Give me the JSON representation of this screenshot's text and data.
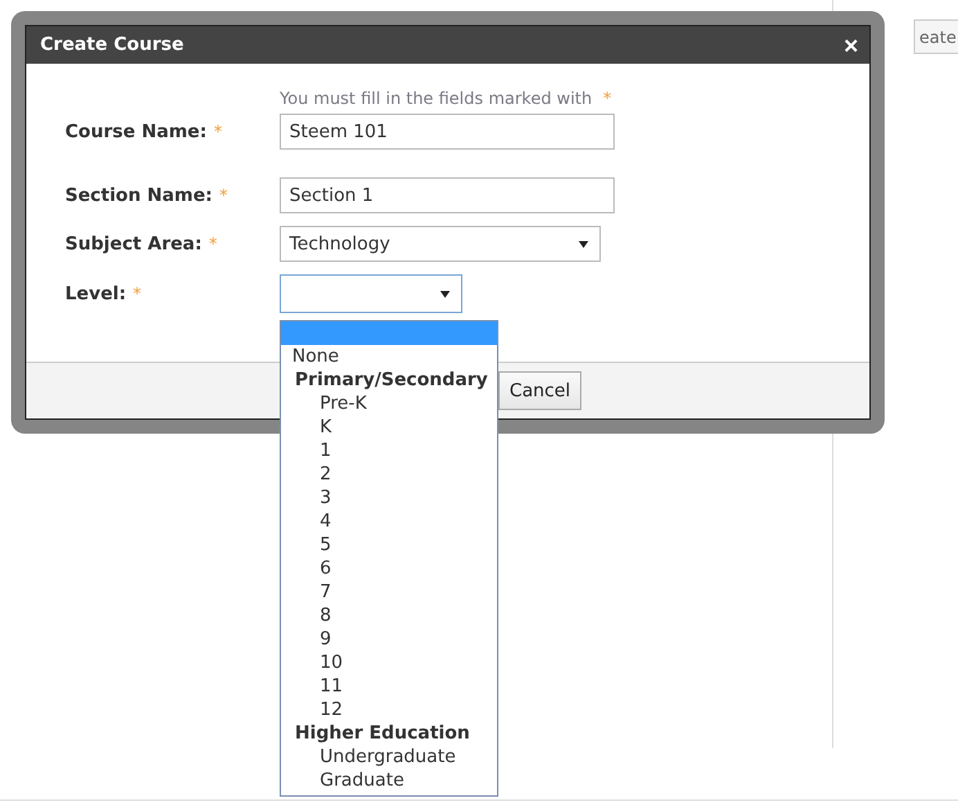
{
  "background": {
    "button_label": "eate"
  },
  "dialog": {
    "title": "Create Course",
    "close": "×",
    "hint": {
      "text": "You must fill in the fields marked with",
      "mark": "*"
    },
    "fields": [
      {
        "kind": "text",
        "label": "Course Name:",
        "mark": "*",
        "value": "Steem 101",
        "focused": false
      },
      {
        "kind": "text",
        "label": "Section Name:",
        "mark": "*",
        "value": "Section 1",
        "focused": false
      },
      {
        "kind": "select",
        "label": "Subject Area:",
        "mark": "*",
        "value": "Technology",
        "focused": false
      },
      {
        "kind": "select-small",
        "label": "Level:",
        "mark": "*",
        "focused": true
      }
    ],
    "buttons": [
      "Cancel"
    ]
  },
  "level_dropdown": {
    "items": [
      {
        "kind": "blank",
        "highlighted": true
      },
      {
        "kind": "option",
        "label": "None",
        "highlighted": false
      },
      {
        "kind": "group",
        "label": "Primary/Secondary",
        "children": [
          {
            "label": "Pre-K",
            "highlighted": false
          },
          {
            "label": "K",
            "highlighted": false
          },
          {
            "label": "1",
            "highlighted": false
          },
          {
            "label": "2",
            "highlighted": false
          },
          {
            "label": "3",
            "highlighted": false
          },
          {
            "label": "4",
            "highlighted": false
          },
          {
            "label": "5",
            "highlighted": false
          },
          {
            "label": "6",
            "highlighted": false
          },
          {
            "label": "7",
            "highlighted": false
          },
          {
            "label": "8",
            "highlighted": false
          },
          {
            "label": "9",
            "highlighted": false
          },
          {
            "label": "10",
            "highlighted": false
          },
          {
            "label": "11",
            "highlighted": false
          },
          {
            "label": "12",
            "highlighted": false
          }
        ]
      },
      {
        "kind": "group",
        "label": "Higher Education",
        "children": [
          {
            "label": "Undergraduate",
            "highlighted": false
          },
          {
            "label": "Graduate",
            "highlighted": false
          }
        ]
      }
    ]
  }
}
